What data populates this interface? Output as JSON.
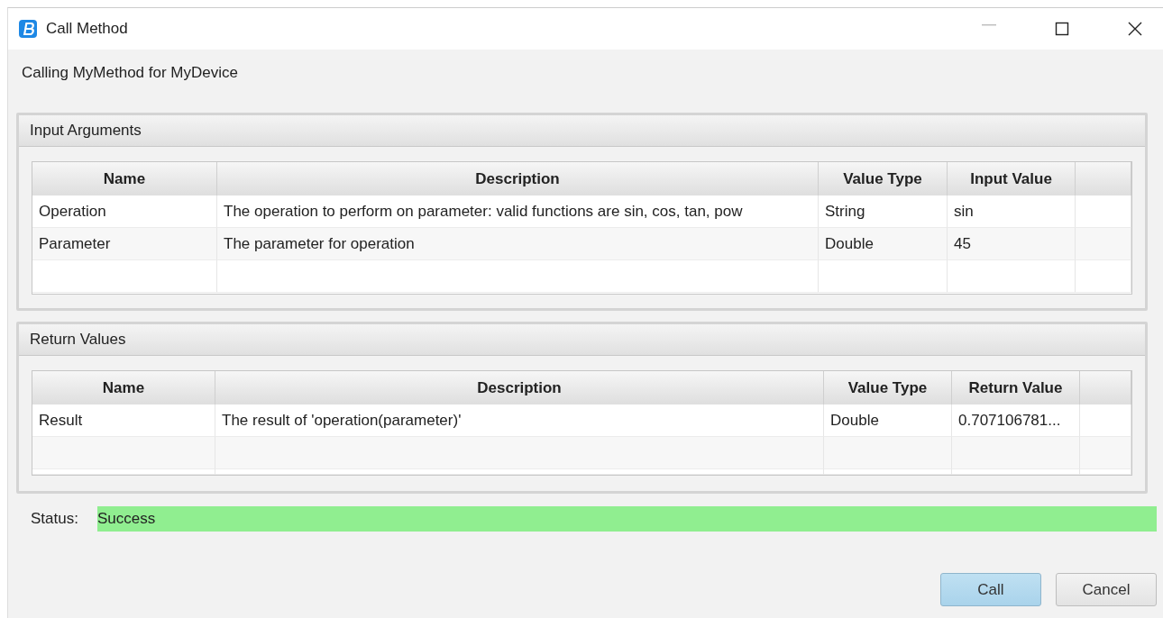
{
  "window": {
    "title": "Call Method"
  },
  "subtitle": "Calling MyMethod for MyDevice",
  "sections": [
    {
      "title": "Input Arguments",
      "table": {
        "columns": [
          "Name",
          "Description",
          "Value Type",
          "Input Value"
        ],
        "rows": [
          {
            "cells": [
              "Operation",
              "The operation to perform on parameter: valid functions are sin, cos, tan, pow",
              "String",
              "sin"
            ]
          },
          {
            "cells": [
              "Parameter",
              "The parameter for operation",
              "Double",
              "45"
            ]
          }
        ]
      }
    },
    {
      "title": "Return Values",
      "table": {
        "columns": [
          "Name",
          "Description",
          "Value Type",
          "Return Value"
        ],
        "rows": [
          {
            "cells": [
              "Result",
              "The result of 'operation(parameter)'",
              "Double",
              "0.707106781..."
            ]
          }
        ]
      }
    }
  ],
  "status": {
    "label": "Status:",
    "value": "Success",
    "kind": "success"
  },
  "buttons": [
    {
      "label": "Call",
      "default": true
    },
    {
      "label": "Cancel",
      "default": false
    }
  ]
}
